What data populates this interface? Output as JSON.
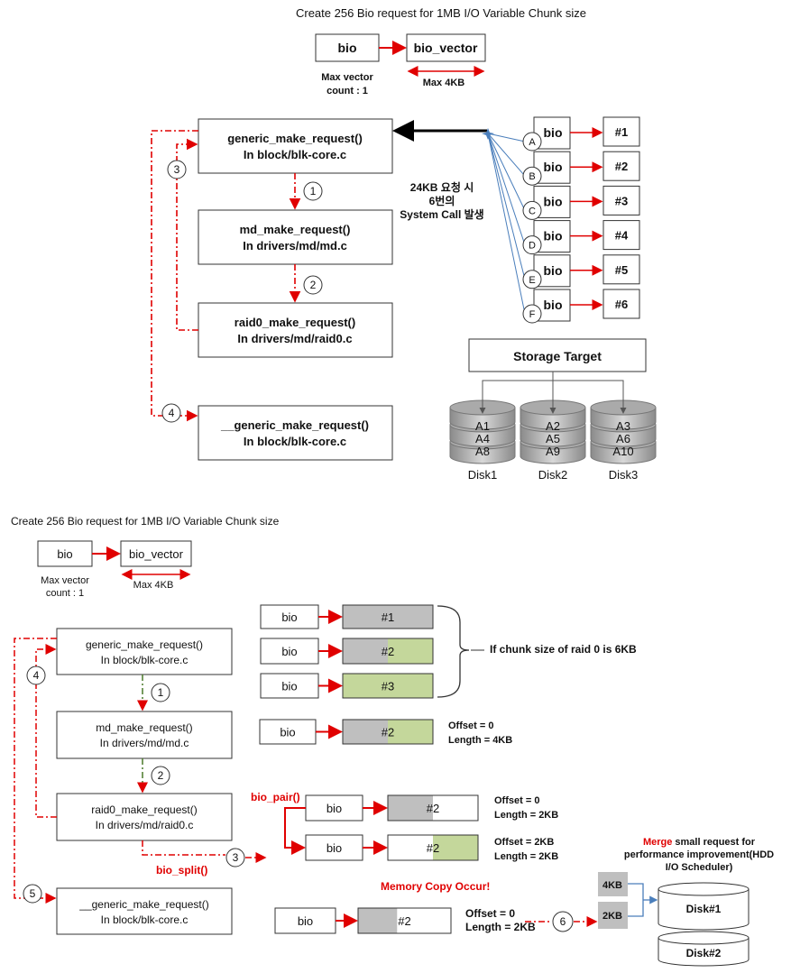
{
  "top": {
    "title": "Create 256 Bio request for 1MB I/O Variable Chunk size",
    "bio": "bio",
    "bio_vector": "bio_vector",
    "max_vector_1": "Max vector",
    "max_vector_2": "count : 1",
    "max_4kb": "Max 4KB",
    "functions": [
      {
        "name": "generic_make_request()",
        "file": "In block/blk-core.c"
      },
      {
        "name": "md_make_request()",
        "file": "In drivers/md/md.c"
      },
      {
        "name": "raid0_make_request()",
        "file": "In drivers/md/raid0.c"
      },
      {
        "name": "__generic_make_request()",
        "file": "In block/blk-core.c"
      }
    ],
    "steps": [
      "1",
      "2",
      "3",
      "4"
    ],
    "syscall_note": [
      "24KB 요청 시",
      "6번의",
      "System Call 발생"
    ],
    "requests": [
      {
        "letter": "A",
        "bio": "bio",
        "chunk": "#1"
      },
      {
        "letter": "B",
        "bio": "bio",
        "chunk": "#2"
      },
      {
        "letter": "C",
        "bio": "bio",
        "chunk": "#3"
      },
      {
        "letter": "D",
        "bio": "bio",
        "chunk": "#4"
      },
      {
        "letter": "E",
        "bio": "bio",
        "chunk": "#5"
      },
      {
        "letter": "F",
        "bio": "bio",
        "chunk": "#6"
      }
    ],
    "storage_target": "Storage Target",
    "disks": [
      {
        "label": "Disk1",
        "blocks": [
          "A1",
          "A4",
          "A8"
        ]
      },
      {
        "label": "Disk2",
        "blocks": [
          "A2",
          "A5",
          "A9"
        ]
      },
      {
        "label": "Disk3",
        "blocks": [
          "A3",
          "A6",
          "A10"
        ]
      }
    ]
  },
  "bottom": {
    "title": "Create 256 Bio request for 1MB I/O Variable Chunk size",
    "bio": "bio",
    "bio_vector": "bio_vector",
    "max_vector_1": "Max vector",
    "max_vector_2": "count : 1",
    "max_4kb": "Max 4KB",
    "functions": [
      {
        "name": "generic_make_request()",
        "file": "In block/blk-core.c"
      },
      {
        "name": "md_make_request()",
        "file": "In drivers/md/md.c"
      },
      {
        "name": "raid0_make_request()",
        "file": "In drivers/md/raid0.c"
      },
      {
        "name": "__generic_make_request()",
        "file": "In block/blk-core.c"
      }
    ],
    "steps": [
      "1",
      "2",
      "3",
      "4",
      "5",
      "6"
    ],
    "chunks": [
      {
        "bio": "bio",
        "chunk": "#1"
      },
      {
        "bio": "bio",
        "chunk": "#2"
      },
      {
        "bio": "bio",
        "chunk": "#3"
      }
    ],
    "chunk_note": "If chunk size of raid 0 is 6KB",
    "md_bio": {
      "bio": "bio",
      "chunk": "#2",
      "offset": "Offset  = 0",
      "length": "Length  = 4KB"
    },
    "bio_pair_label": "bio_pair()",
    "pair": [
      {
        "bio": "bio",
        "chunk": "#2",
        "offset": "Offset  = 0",
        "length": "Length  = 2KB"
      },
      {
        "bio": "bio",
        "chunk": "#2",
        "offset": "Offset  = 2KB",
        "length": "Length  = 2KB"
      }
    ],
    "bio_split_label": "bio_split()",
    "memory_copy": "Memory Copy Occur!",
    "final_bio": {
      "bio": "bio",
      "chunk": "#2",
      "offset": "Offset  = 0",
      "length": "Length  = 2KB"
    },
    "merge_note": [
      "Merge",
      " small request for",
      "performance improvement(HDD",
      "I/O Scheduler)"
    ],
    "queue": [
      "4KB",
      "2KB"
    ],
    "disks": [
      "Disk#1",
      "Disk#2"
    ]
  },
  "colors": {
    "arrow_red": "#e00000",
    "gray_fill": "#bfbfbf",
    "green_fill": "#c4d79b",
    "blue_line": "#4a7ebb"
  }
}
